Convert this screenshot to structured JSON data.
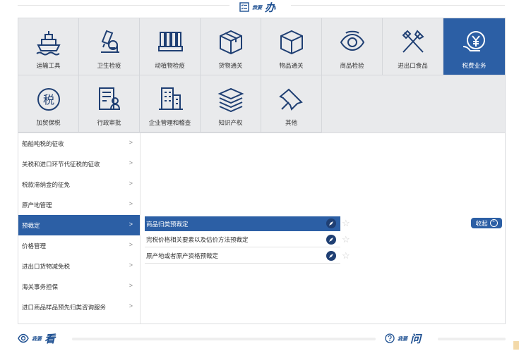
{
  "header": {
    "small": "我要",
    "big": "办",
    "icon": "checklist-icon"
  },
  "tiles": [
    {
      "label": "运输工具",
      "icon": "ship-icon"
    },
    {
      "label": "卫生检疫",
      "icon": "microscope-icon"
    },
    {
      "label": "动植物检疫",
      "icon": "plant-quarantine-icon"
    },
    {
      "label": "货物通关",
      "icon": "cargo-box-icon"
    },
    {
      "label": "物品通关",
      "icon": "item-box-icon"
    },
    {
      "label": "商品检验",
      "icon": "eye-inspection-icon"
    },
    {
      "label": "进出口食品",
      "icon": "fork-knife-icon"
    },
    {
      "label": "税费业务",
      "icon": "yuan-hand-icon",
      "active": true
    },
    {
      "label": "加贸保税",
      "icon": "tax-seal-icon"
    },
    {
      "label": "行政审批",
      "icon": "approval-doc-icon"
    },
    {
      "label": "企业管理和稽查",
      "icon": "building-icon"
    },
    {
      "label": "知识产权",
      "icon": "books-icon"
    },
    {
      "label": "其他",
      "icon": "pin-icon"
    }
  ],
  "sidebar": [
    {
      "label": "船舶吨税的征收"
    },
    {
      "label": "关税和进口环节代征税的征收"
    },
    {
      "label": "税款滞纳金的征免"
    },
    {
      "label": "原产地管理"
    },
    {
      "label": "预裁定",
      "active": true
    },
    {
      "label": "价格管理"
    },
    {
      "label": "进出口货物减免税"
    },
    {
      "label": "海关事务担保"
    },
    {
      "label": "进口商品样品预先归类咨询服务"
    }
  ],
  "subitems": [
    {
      "label": "商品归类预裁定",
      "active": true
    },
    {
      "label": "完税价格相关要素以及估价方法预裁定"
    },
    {
      "label": "原产地或者原产资格预裁定"
    }
  ],
  "collapse_label": "收起",
  "footer": {
    "left": {
      "small": "我要",
      "big": "看",
      "icon": "eye-icon"
    },
    "right": {
      "small": "我要",
      "big": "问",
      "icon": "question-icon"
    }
  },
  "colors": {
    "primary": "#2c5fa5",
    "dark": "#1f3f73",
    "tile_bg": "#e9eaec"
  }
}
